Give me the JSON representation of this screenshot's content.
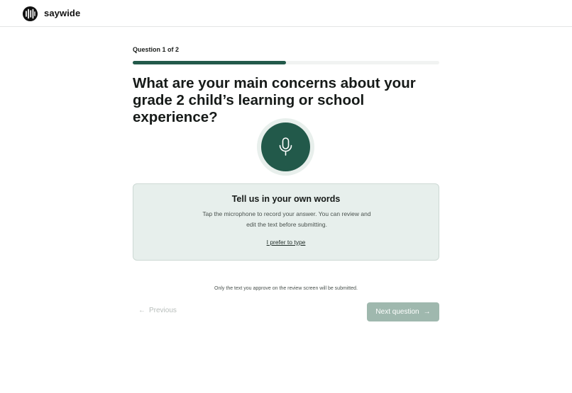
{
  "header": {
    "brand": "saywide",
    "logo_icon": "saywide-logo-icon"
  },
  "question": {
    "counter": "Question 1 of 2",
    "progress": 0.5,
    "text": "What are your main concerns about your grade 2 child’s learning or school experience?"
  },
  "mic": {
    "icon": "microphone-icon"
  },
  "card": {
    "title": "Tell us in your own words",
    "description": "Tap the microphone to record your answer. You can review and edit the text before submitting.",
    "type_link": "I prefer to type"
  },
  "footer": {
    "disclaimer": "Only the text you approve on the review screen will be submitted.",
    "previous_label": "Previous",
    "next_label": "Next question"
  },
  "colors": {
    "accent": "#22594a",
    "card_bg": "#e7efec",
    "next_button_disabled": "#9fb8ae"
  }
}
